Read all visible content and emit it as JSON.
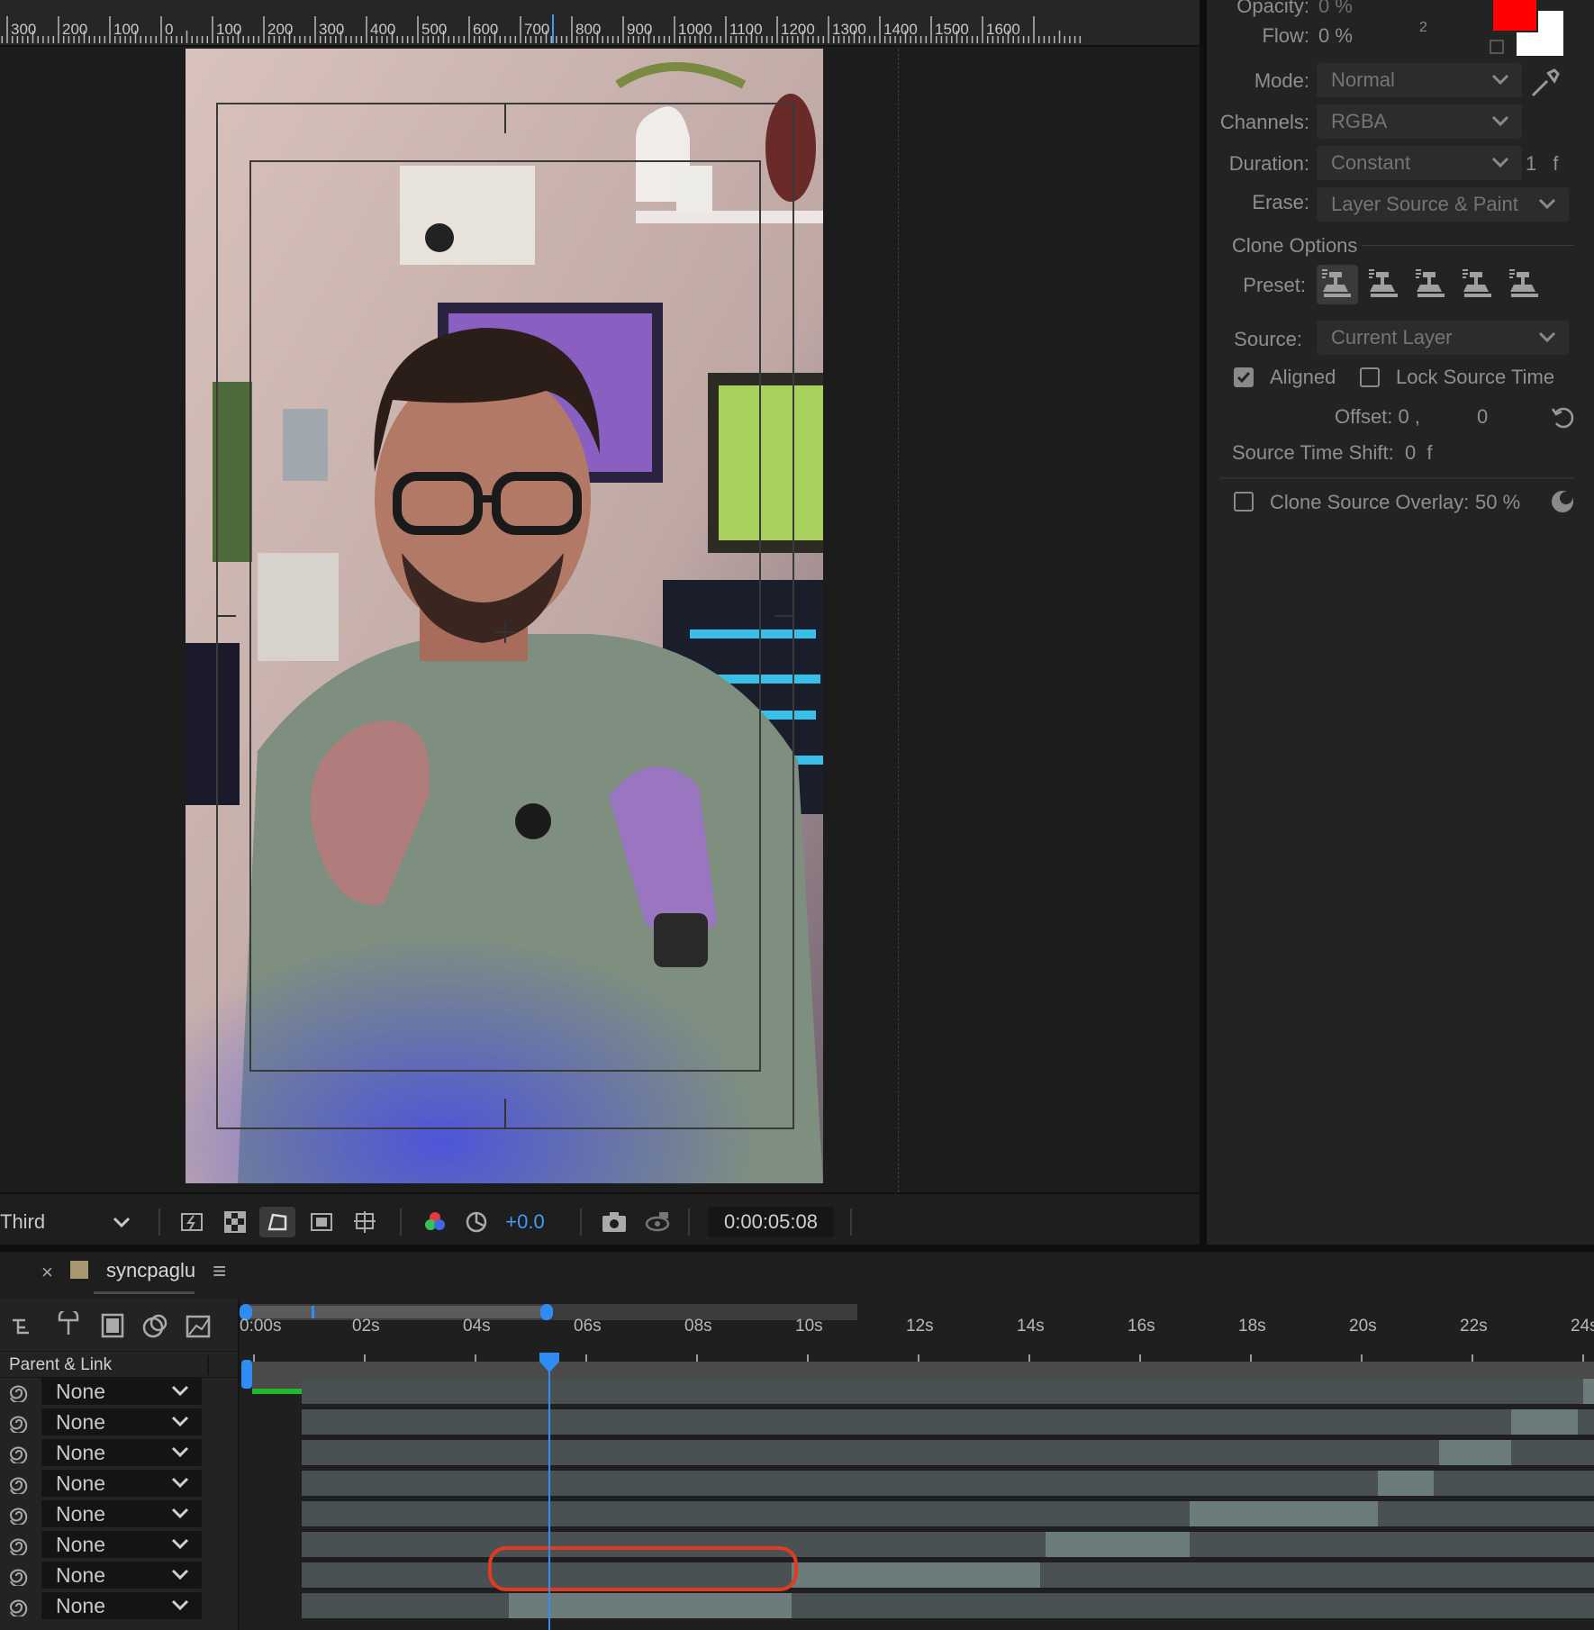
{
  "ruler": {
    "labels": [
      "300",
      "200",
      "100",
      "0",
      "100",
      "200",
      "300",
      "400",
      "500",
      "600",
      "700",
      "800",
      "900",
      "1000",
      "1100",
      "1200",
      "1300",
      "1400",
      "1500",
      "1600"
    ]
  },
  "viewer_toolbar": {
    "view_select": "Third",
    "exposure": "+0.0",
    "timecode": "0:00:05:08"
  },
  "paint_panel": {
    "opacity_label": "Opacity:",
    "opacity_value": "0 %",
    "flow_label": "Flow:",
    "flow_value": "0 %",
    "badge": "2",
    "foreground_color": "#ff0000",
    "background_color": "#ffffff",
    "mode_label": "Mode:",
    "mode_value": "Normal",
    "channels_label": "Channels:",
    "channels_value": "RGBA",
    "duration_label": "Duration:",
    "duration_value": "Constant",
    "duration_frames": "1 f",
    "erase_label": "Erase:",
    "erase_value": "Layer Source & Paint",
    "clone_options": "Clone Options",
    "preset_label": "Preset:",
    "source_label": "Source:",
    "source_value": "Current Layer",
    "aligned_label": "Aligned",
    "lock_source_label": "Lock Source Time",
    "offset_label": "Offset: 0 ,",
    "offset_y": "0",
    "source_time_shift": "Source Time Shift:  0  f",
    "clone_overlay_label": "Clone Source Overlay:",
    "clone_overlay_value": "50 %"
  },
  "timeline": {
    "comp_tab": "syncpaglu",
    "close_glyph": "×",
    "menu_glyph": "≡",
    "column_header": "Parent & Link",
    "time_labels": [
      "0:00s",
      "02s",
      "04s",
      "06s",
      "08s",
      "10s",
      "12s",
      "14s",
      "16s",
      "18s",
      "20s",
      "22s",
      "24s"
    ],
    "parent_value": "None",
    "playhead_seconds": 5.33,
    "layers": [
      {
        "parent": "None",
        "start": 24.0,
        "end": 25.0
      },
      {
        "parent": "None",
        "start": 22.7,
        "end": 23.9
      },
      {
        "parent": "None",
        "start": 21.4,
        "end": 22.7
      },
      {
        "parent": "None",
        "start": 20.3,
        "end": 21.3
      },
      {
        "parent": "None",
        "start": 16.9,
        "end": 20.3
      },
      {
        "parent": "None",
        "start": 14.3,
        "end": 16.9
      },
      {
        "parent": "None",
        "start": 9.7,
        "end": 14.2
      },
      {
        "parent": "None",
        "start": 4.6,
        "end": 9.7
      }
    ]
  }
}
